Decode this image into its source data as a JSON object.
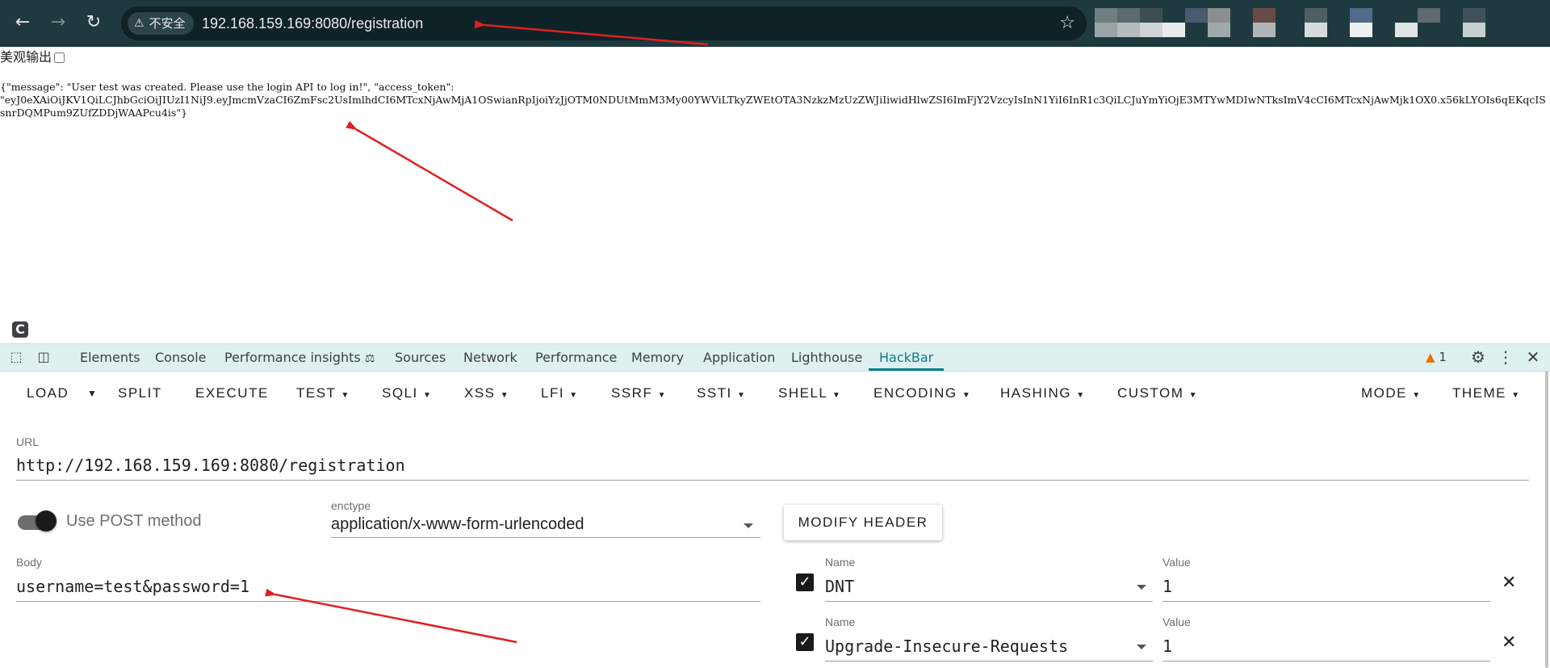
{
  "browser": {
    "back_icon": "arrow-left",
    "forward_icon": "arrow-right",
    "reload_icon": "reload",
    "security_label": "不安全",
    "url": "192.168.159.169:8080/registration"
  },
  "page": {
    "beautify_label": "美观输出",
    "json_output": "{\"message\": \"User test was created. Please use the login API to log in!\", \"access_token\":\n\"eyJ0eXAiOiJKV1QiLCJhbGciOiJIUzI1NiJ9.eyJmcmVzaCI6ZmFsc2UsImlhdCI6MTcxNjAwMjA1OSwianRpIjoiYzJjOTM0NDUtMmM3My00YWViLTkyZWEtOTA3NzkzMzUzZWJiIiwidHlwZSI6ImFjY2VzcyIsInN1YiI6InR1c3QiLCJuYmYiOjE3MTYwMDIwNTksImV4cCI6MTcxNjAwMjk1OX0.x56kLYOIs6qEKqcISsnrDQMPum9ZUfZDDjWAAPcu4is\"}"
  },
  "devtools": {
    "tabs": [
      "Elements",
      "Console",
      "Performance insights",
      "Sources",
      "Network",
      "Performance",
      "Memory",
      "Application",
      "Lighthouse",
      "HackBar"
    ],
    "active_tab": "HackBar",
    "warning_count": "1"
  },
  "hackbar": {
    "toolbar": {
      "load": "LOAD",
      "split": "SPLIT",
      "execute": "EXECUTE",
      "test": "TEST",
      "sqli": "SQLI",
      "xss": "XSS",
      "lfi": "LFI",
      "ssrf": "SSRF",
      "ssti": "SSTI",
      "shell": "SHELL",
      "encoding": "ENCODING",
      "hashing": "HASHING",
      "custom": "CUSTOM",
      "mode": "MODE",
      "theme": "THEME"
    },
    "url_label": "URL",
    "url_value": "http://192.168.159.169:8080/registration",
    "use_post_label": "Use POST method",
    "use_post_enabled": true,
    "enctype_label": "enctype",
    "enctype_value": "application/x-www-form-urlencoded",
    "modify_header_label": "MODIFY HEADER",
    "body_label": "Body",
    "body_value": "username=test&password=1",
    "headers": [
      {
        "enabled": true,
        "name_label": "Name",
        "name": "DNT",
        "value_label": "Value",
        "value": "1"
      },
      {
        "enabled": true,
        "name_label": "Name",
        "name": "Upgrade-Insecure-Requests",
        "value_label": "Value",
        "value": "1"
      }
    ]
  },
  "colors": {
    "topbar": "#1f3a3f",
    "devtools_tabbar": "#dff0f0",
    "active_tab": "#0b7d8a",
    "annotation_arrow": "#e02020"
  }
}
